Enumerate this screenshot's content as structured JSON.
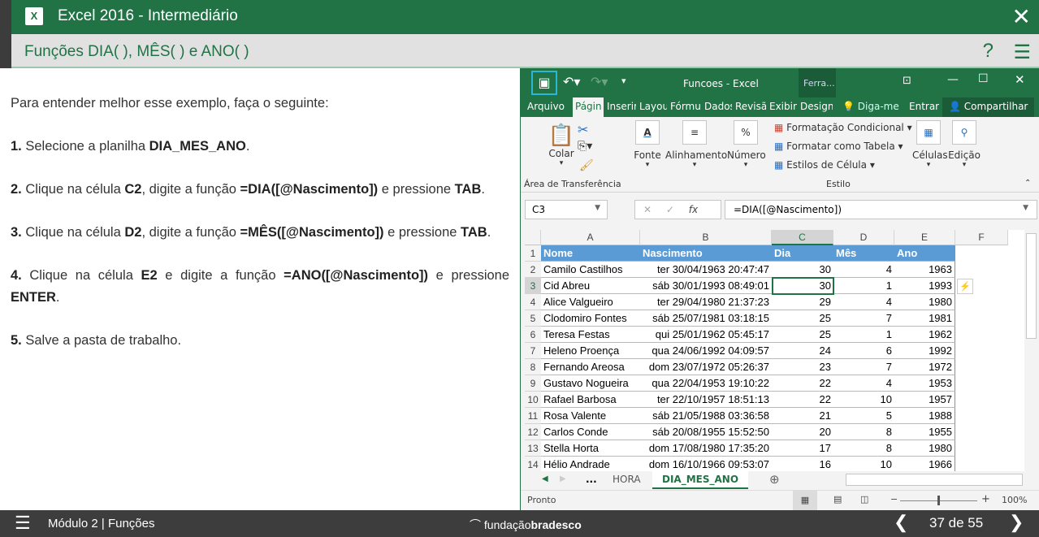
{
  "app": {
    "title": "Excel 2016 - Intermediário",
    "lesson": "Funções DIA( ), MÊS( ) e ANO( )"
  },
  "content": {
    "intro": "Para entender melhor esse exemplo, faça o seguinte:",
    "steps": [
      {
        "n": "1.",
        "parts": [
          " Selecione a planilha ",
          "DIA_MES_ANO",
          "."
        ]
      },
      {
        "n": "2.",
        "parts": [
          " Clique na célula ",
          "C2",
          ", digite a função ",
          "=DIA([@Nascimento])",
          " e pressione ",
          "TAB",
          "."
        ]
      },
      {
        "n": "3.",
        "parts": [
          " Clique na célula ",
          "D2",
          ", digite a função ",
          "=MÊS([@Nascimento])",
          " e pressione ",
          "TAB",
          "."
        ]
      },
      {
        "n": "4.",
        "parts": [
          " Clique na célula ",
          "E2",
          " e digite a função ",
          "=ANO([@Nascimento])",
          " e pressione ",
          "ENTER",
          "."
        ]
      },
      {
        "n": "5.",
        "parts": [
          " Salve a pasta de trabalho."
        ]
      }
    ]
  },
  "excel": {
    "window_title": "Funcoes - Excel",
    "context_tab": "Ferra...",
    "tabs": [
      "Arquivo",
      "Págin",
      "Inserir",
      "Layou",
      "Fórmu",
      "Dados",
      "Revisã",
      "Exibir",
      "Design"
    ],
    "tell_me": "Diga-me",
    "sign_in": "Entrar",
    "share": "Compartilhar",
    "ribbon": {
      "paste": "Colar",
      "clipboard": "Área de Transferência",
      "font": "Fonte",
      "align": "Alinhamento",
      "number": "Número",
      "cond_format": "Formatação Condicional",
      "format_table": "Formatar como Tabela",
      "cell_styles": "Estilos de Célula",
      "style_group": "Estilo",
      "cells": "Células",
      "editing": "Edição"
    },
    "name_box": "C3",
    "formula": "=DIA([@Nascimento])",
    "columns": [
      "A",
      "B",
      "C",
      "D",
      "E",
      "F"
    ],
    "header": [
      "Nome",
      "Nascimento",
      "Dia",
      "Mês",
      "Ano"
    ],
    "rows": [
      [
        "Camilo Castilhos",
        "ter 30/04/1963 20:47:47",
        "30",
        "4",
        "1963"
      ],
      [
        "Cid Abreu",
        "sáb 30/01/1993 08:49:01",
        "30",
        "1",
        "1993"
      ],
      [
        "Alice Valgueiro",
        "ter 29/04/1980 21:37:23",
        "29",
        "4",
        "1980"
      ],
      [
        "Clodomiro Fontes",
        "sáb 25/07/1981 03:18:15",
        "25",
        "7",
        "1981"
      ],
      [
        "Teresa Festas",
        "qui 25/01/1962 05:45:17",
        "25",
        "1",
        "1962"
      ],
      [
        "Heleno Proença",
        "qua 24/06/1992 04:09:57",
        "24",
        "6",
        "1992"
      ],
      [
        "Fernando Areosa",
        "dom 23/07/1972 05:26:37",
        "23",
        "7",
        "1972"
      ],
      [
        "Gustavo Nogueira",
        "qua 22/04/1953 19:10:22",
        "22",
        "4",
        "1953"
      ],
      [
        "Rafael Barbosa",
        "ter 22/10/1957 18:51:13",
        "22",
        "10",
        "1957"
      ],
      [
        "Rosa Valente",
        "sáb 21/05/1988 03:36:58",
        "21",
        "5",
        "1988"
      ],
      [
        "Carlos Conde",
        "sáb 20/08/1955 15:52:50",
        "20",
        "8",
        "1955"
      ],
      [
        "Stella Horta",
        "dom 17/08/1980 17:35:20",
        "17",
        "8",
        "1980"
      ],
      [
        "Hélio Andrade",
        "dom 16/10/1966 09:53:07",
        "16",
        "10",
        "1966"
      ]
    ],
    "sheet_tabs": [
      "...",
      "HORA",
      "DIA_MES_ANO"
    ],
    "status": "Pronto",
    "zoom": "100%"
  },
  "footer": {
    "module": "Módulo 2 | Funções",
    "brand_a": "fundação",
    "brand_b": "bradesco",
    "page": "37 de 55"
  }
}
